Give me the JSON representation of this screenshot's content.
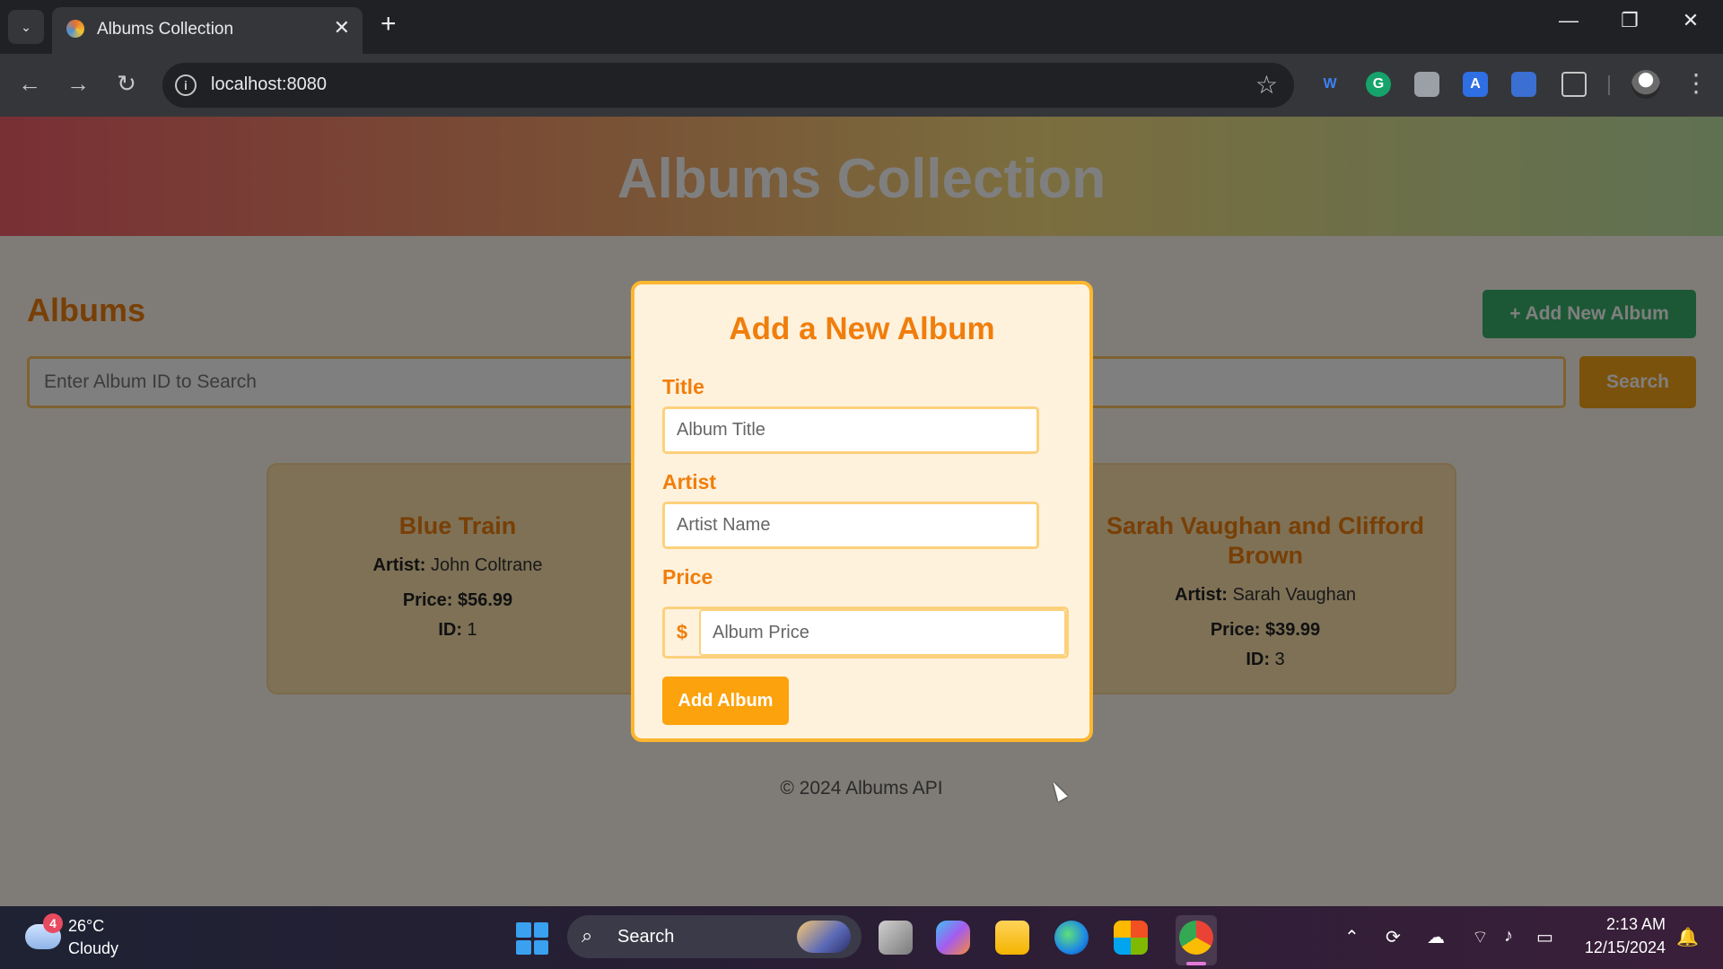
{
  "browser": {
    "tab_title": "Albums Collection",
    "tab_close_glyph": "✕",
    "new_tab_glyph": "+",
    "url": "localhost:8080",
    "window_controls": [
      "—",
      "❐",
      "✕"
    ]
  },
  "page": {
    "header_title": "Albums Collection",
    "section_title": "Albums",
    "add_new_label": "+ Add New Album",
    "search_placeholder": "Enter Album ID to Search",
    "search_label": "Search",
    "albums": [
      {
        "title": "Blue Train",
        "artist_label": "Artist:",
        "artist": "John Coltrane",
        "price": "Price: $56.99",
        "id_label": "ID:",
        "id": "1"
      },
      {
        "title": "Sarah Vaughan and Clifford Brown",
        "artist_label": "Artist:",
        "artist": "Sarah Vaughan",
        "price": "Price: $39.99",
        "id_label": "ID:",
        "id": "3"
      }
    ],
    "footer": "© 2024 Albums API"
  },
  "modal": {
    "title": "Add a New Album",
    "title_label": "Title",
    "title_placeholder": "Album Title",
    "artist_label": "Artist",
    "artist_placeholder": "Artist Name",
    "price_label": "Price",
    "price_prefix": "$",
    "price_placeholder": "Album Price",
    "submit_label": "Add Album"
  },
  "taskbar": {
    "weather_badge": "4",
    "temperature": "26°C",
    "condition": "Cloudy",
    "search_label": "Search",
    "time": "2:13 AM",
    "date": "12/15/2024"
  },
  "colors": {
    "accent_orange": "#f07e0c",
    "add_button_green": "#38b06b",
    "search_button": "#f7a417",
    "modal_border": "#fcb62f"
  }
}
